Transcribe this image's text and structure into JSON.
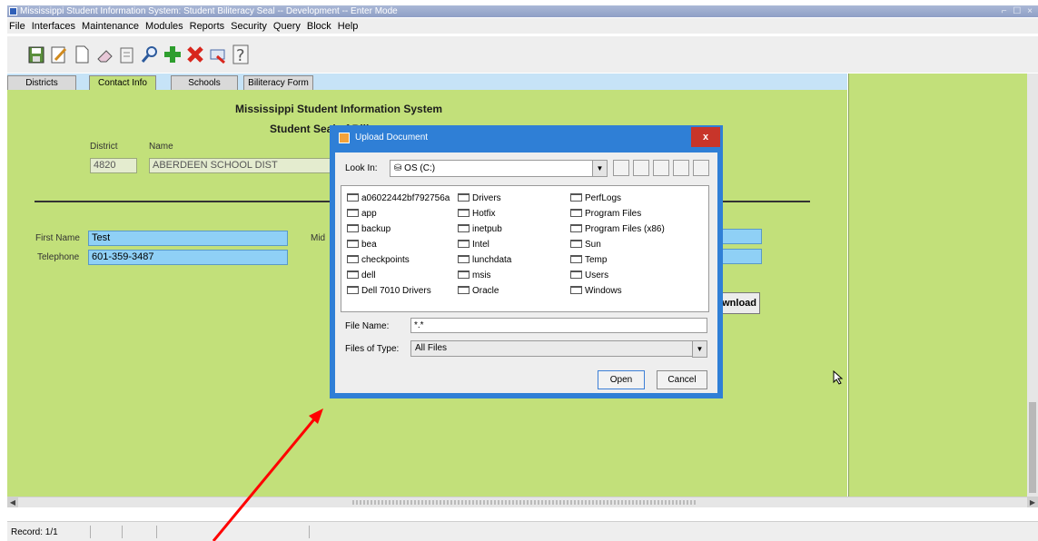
{
  "window": {
    "title": "Mississippi Student Information System: Student Biliteracy Seal -- Development -- Enter Mode",
    "controls": "⌐ ☐ ×"
  },
  "menu": [
    "File",
    "Interfaces",
    "Maintenance",
    "Modules",
    "Reports",
    "Security",
    "Query",
    "Block",
    "Help"
  ],
  "tabs": [
    "Districts",
    "Contact Info",
    "Schools",
    "Biliteracy Form"
  ],
  "form": {
    "title": "Mississippi Student Information System",
    "subtitle": "Student Seal of Biliteracy",
    "district_label": "District",
    "name_label": "Name",
    "district_code": "4820",
    "district_name": "ABERDEEN SCHOOL DIST",
    "first_name_label": "First Name",
    "first_name": "Test",
    "middle_label": "Mid",
    "telephone_label": "Telephone",
    "telephone": "601-359-3487",
    "download_button": "wnload"
  },
  "dialog": {
    "title": "Upload Document",
    "close": "x",
    "look_in_label": "Look In:",
    "look_in_value": "OS (C:)",
    "files": [
      "a06022442bf792756a",
      "app",
      "backup",
      "bea",
      "checkpoints",
      "dell",
      "Dell 7010 Drivers",
      "Drivers",
      "Hotfix",
      "inetpub",
      "Intel",
      "lunchdata",
      "msis",
      "Oracle",
      "PerfLogs",
      "Program Files",
      "Program Files (x86)",
      "Sun",
      "Temp",
      "Users",
      "Windows"
    ],
    "file_name_label": "File Name:",
    "file_name_value": "*.*",
    "file_type_label": "Files of Type:",
    "file_type_value": "All Files",
    "open_button": "Open",
    "cancel_button": "Cancel"
  },
  "status": {
    "record": "Record: 1/1"
  },
  "colors": {
    "form_bg": "#c2e07a",
    "field_blue": "#8fd0f6",
    "dialog_frame": "#2f7fd6",
    "close_red": "#c8352a",
    "annotation_arrow": "#ff0000"
  },
  "icons": [
    "save-icon",
    "edit-icon",
    "new-doc-icon",
    "eraser-icon",
    "print-icon",
    "search-icon",
    "add-icon",
    "delete-icon",
    "exit-icon",
    "help-icon"
  ]
}
